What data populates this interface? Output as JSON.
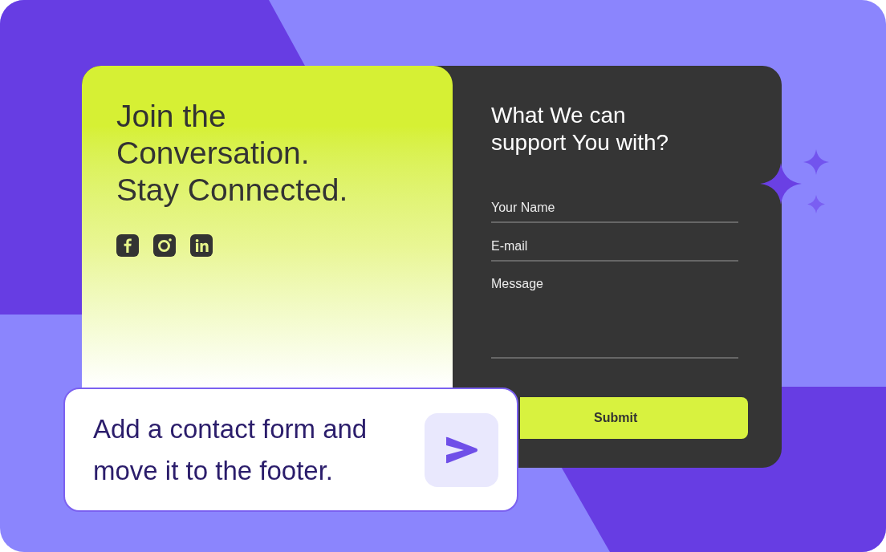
{
  "promo_card": {
    "heading": "Join the\nConversation.\nStay Connected.",
    "social_links": [
      {
        "kind": "facebook"
      },
      {
        "kind": "instagram"
      },
      {
        "kind": "linkedin"
      }
    ]
  },
  "contact_form": {
    "heading": "What We can\nsupport You with?",
    "fields": [
      {
        "kind": "input",
        "placeholder": "Your Name"
      },
      {
        "kind": "input",
        "placeholder": "E-mail"
      },
      {
        "kind": "textarea",
        "placeholder": "Message"
      }
    ],
    "submit_button": "Submit"
  },
  "prompt": {
    "text": "Add a contact form and\nmove it to the footer."
  }
}
